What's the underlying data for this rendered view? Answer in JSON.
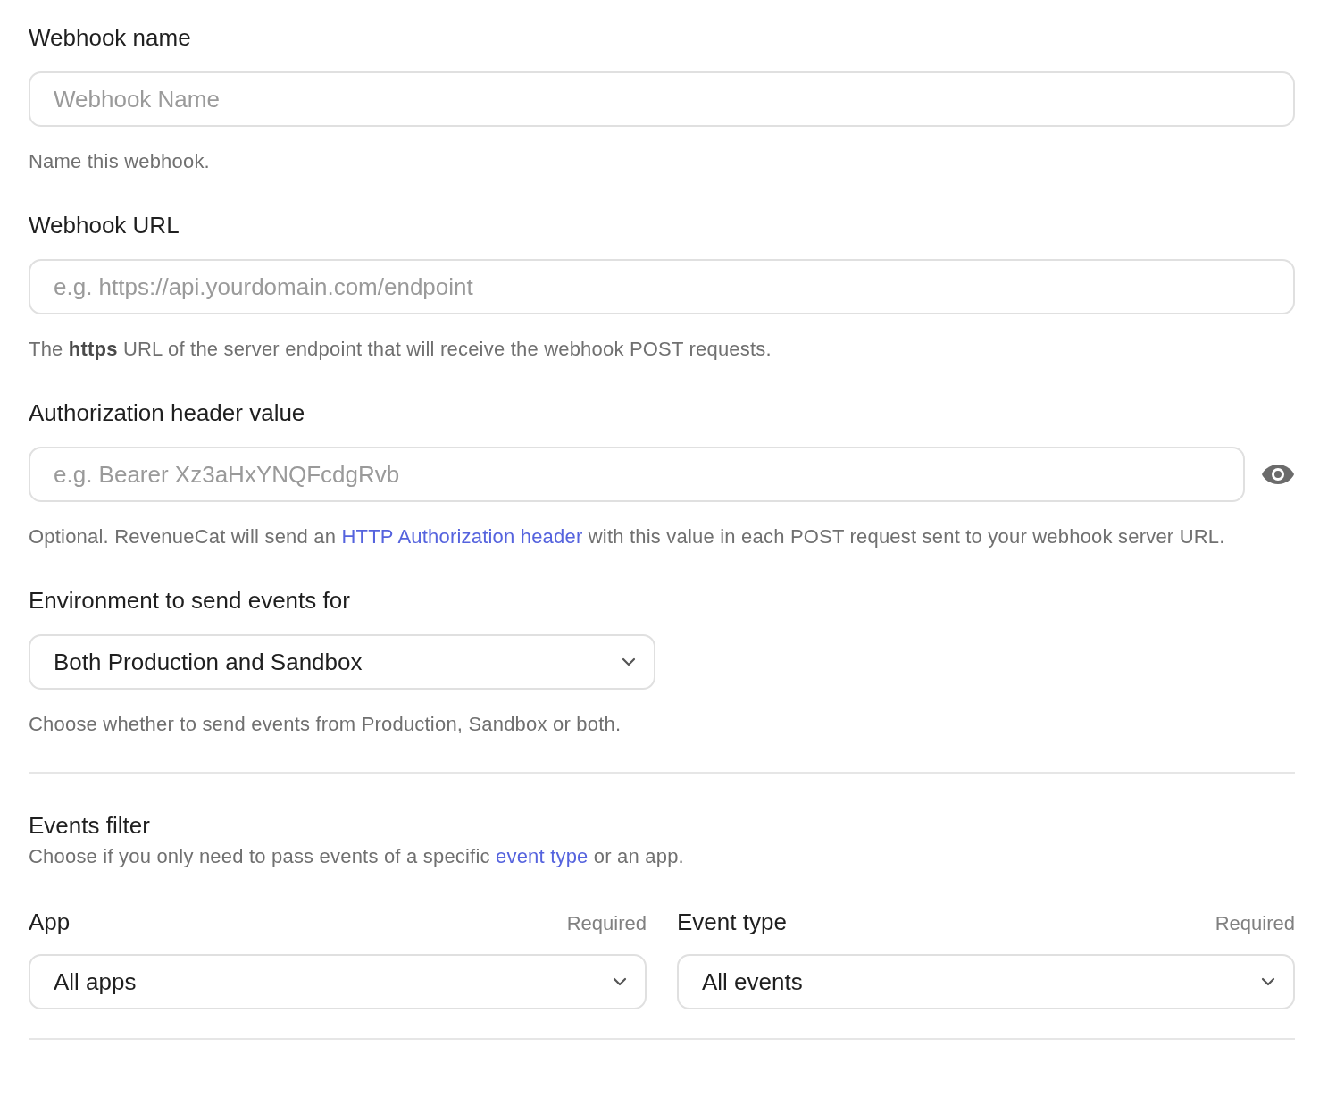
{
  "fields": [
    {
      "kind": "text",
      "label": "Webhook name",
      "placeholder": "Webhook Name",
      "help": [
        {
          "kind": "text",
          "text": "Name this webhook."
        }
      ]
    },
    {
      "kind": "text",
      "label": "Webhook URL",
      "placeholder": "e.g. https://api.yourdomain.com/endpoint",
      "help": [
        {
          "kind": "text",
          "text": "The **https** URL of the server endpoint that will receive the webhook POST requests."
        }
      ]
    },
    {
      "kind": "secret",
      "label": "Authorization header value",
      "placeholder": "e.g. Bearer Xz3aHxYNQFcdgRvb",
      "help": [
        {
          "kind": "text",
          "text": "Optional. RevenueCat will send an "
        },
        {
          "kind": "link",
          "text": "HTTP Authorization header"
        },
        {
          "kind": "text",
          "text": " with this value in each POST request sent to your webhook server URL."
        }
      ]
    },
    {
      "kind": "select",
      "label": "Environment to send events for",
      "value": "Both Production and Sandbox",
      "help": [
        {
          "kind": "text",
          "text": "Choose whether to send events from Production, Sandbox or both."
        }
      ]
    }
  ],
  "events_filter": {
    "title": "Events filter",
    "description": [
      {
        "kind": "text",
        "text": "Choose if you only need to pass events of a specific "
      },
      {
        "kind": "link",
        "text": "event type"
      },
      {
        "kind": "text",
        "text": " or an app."
      }
    ],
    "selects": [
      {
        "label": "App",
        "required": "Required",
        "value": "All apps"
      },
      {
        "label": "Event type",
        "required": "Required",
        "value": "All events"
      }
    ]
  }
}
